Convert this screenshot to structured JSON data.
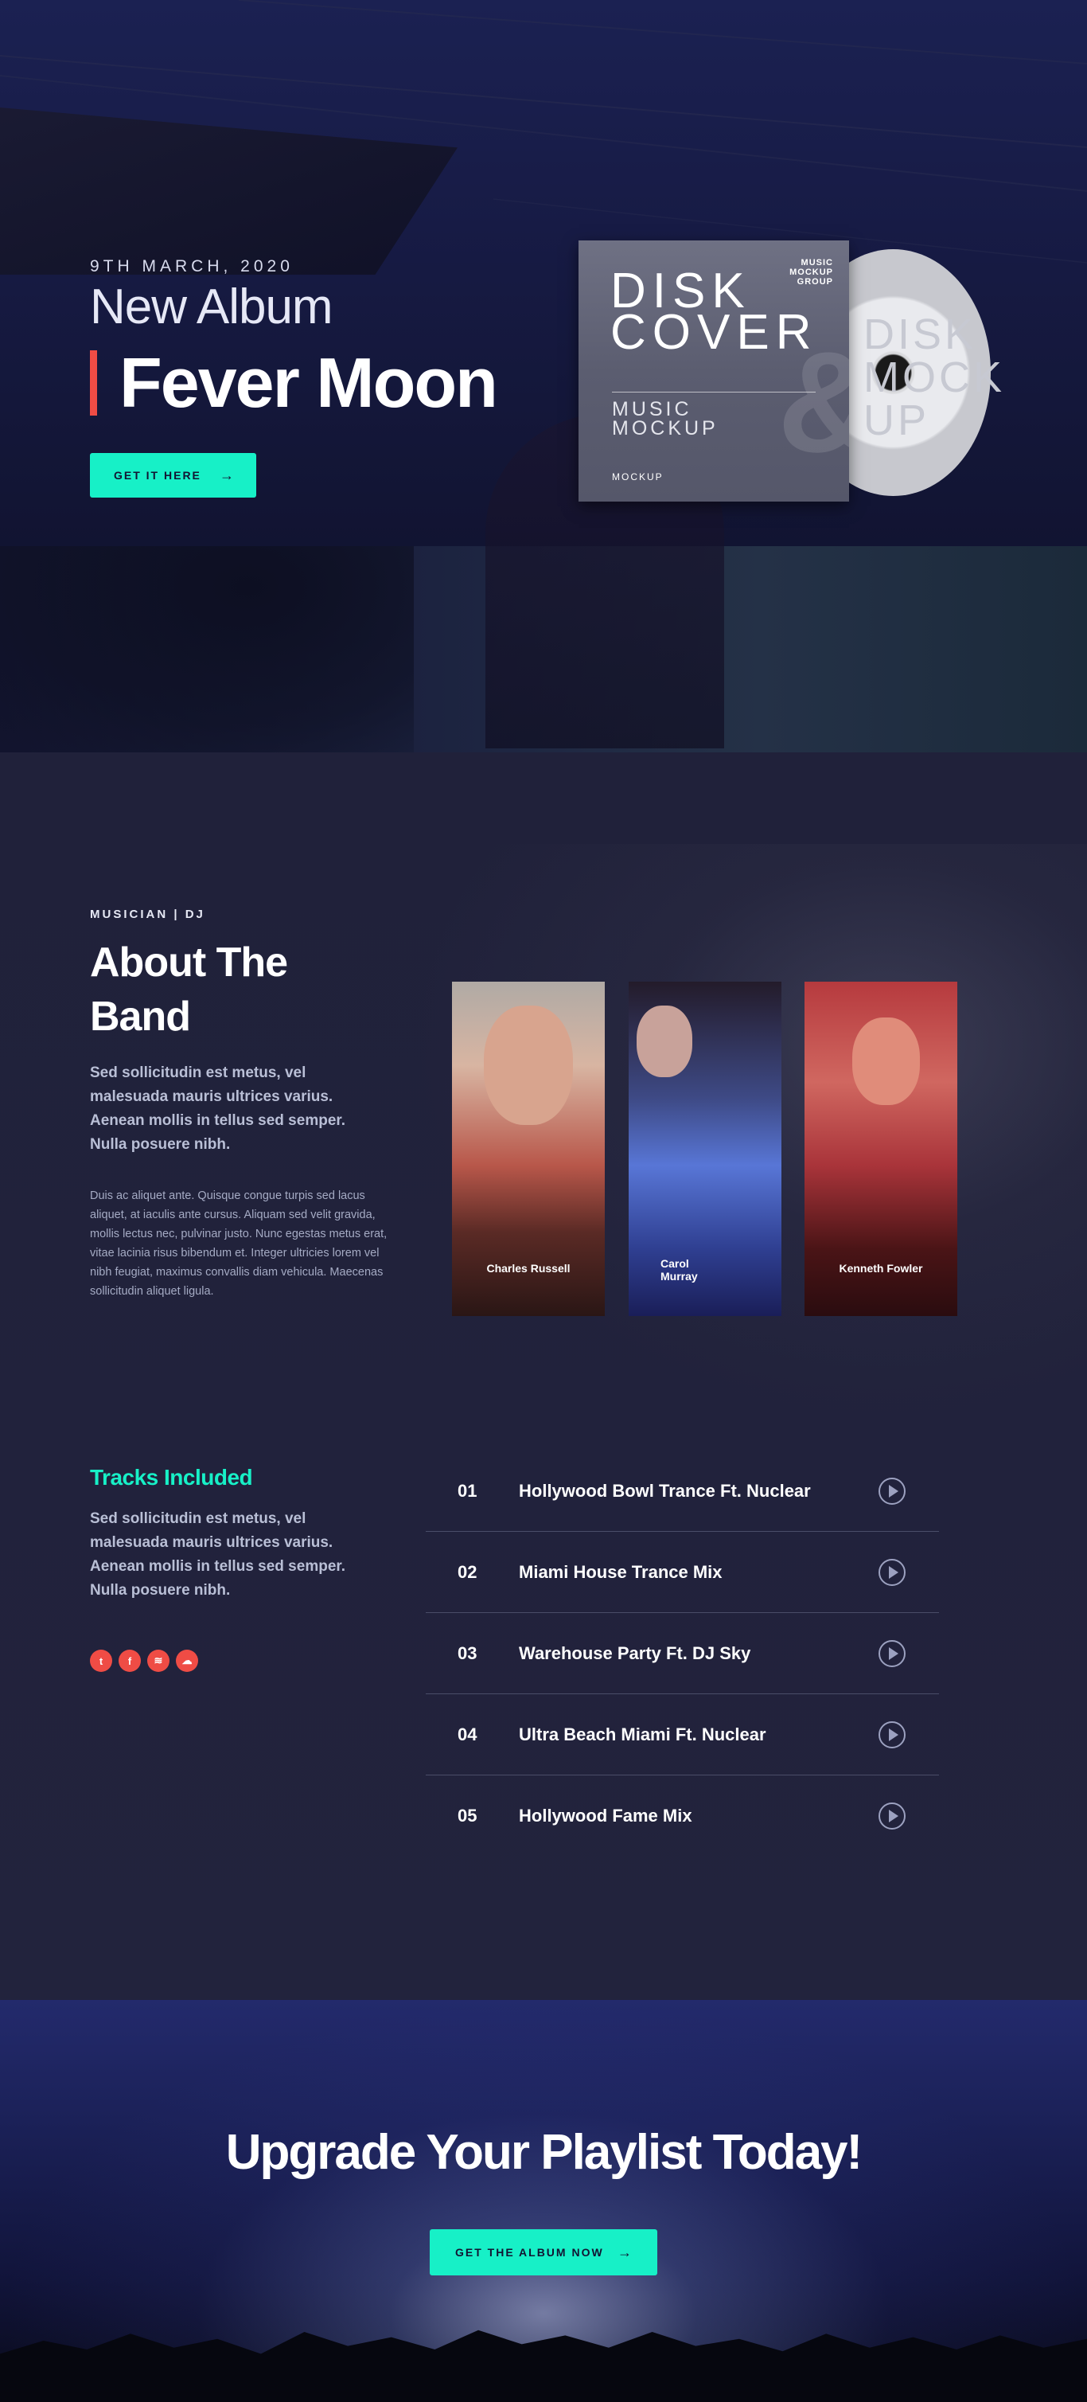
{
  "hero": {
    "date": "9TH MARCH, 2020",
    "subtitle": "New Album",
    "title": "Fever Moon",
    "button_label": "GET IT HERE",
    "button_arrow": "→",
    "cover": {
      "title_line1": "DISK",
      "title_line2": "COVER",
      "badge_line1": "MUSIC",
      "badge_line2": "MOCKUP",
      "badge_line3": "GROUP",
      "sub_line1": "MUSIC",
      "sub_line2": "MOCKUP",
      "logo": "MOCKUP",
      "disc_text": "DISK MOCK UP"
    }
  },
  "about": {
    "eyebrow": "MUSICIAN | DJ",
    "title": "About The Band",
    "lead": "Sed sollicitudin est metus, vel malesuada mauris ultrices varius. Aenean mollis in tellus sed semper. Nulla posuere nibh.",
    "body": "Duis ac aliquet ante. Quisque congue turpis sed lacus aliquet, at iaculis ante cursus. Aliquam sed velit gravida, mollis lectus nec, pulvinar justo. Nunc egestas metus erat, vitae lacinia risus bibendum et. Integer ultricies lorem vel nibh feugiat, maximus convallis diam vehicula. Maecenas sollicitudin aliquet ligula.",
    "members": [
      {
        "name": "Charles Russell"
      },
      {
        "name": "Carol Murray"
      },
      {
        "name": "Kenneth Fowler"
      }
    ]
  },
  "tracks": {
    "title": "Tracks Included",
    "lead": "Sed sollicitudin est metus, vel malesuada mauris ultrices varius. Aenean mollis in tellus sed semper. Nulla posuere nibh.",
    "socials": [
      {
        "icon": "twitter-icon",
        "glyph": "t"
      },
      {
        "icon": "facebook-icon",
        "glyph": "f"
      },
      {
        "icon": "spotify-icon",
        "glyph": "≋"
      },
      {
        "icon": "soundcloud-icon",
        "glyph": "☁"
      }
    ],
    "list": [
      {
        "num": "01",
        "title": "Hollywood Bowl Trance Ft. Nuclear"
      },
      {
        "num": "02",
        "title": "Miami House Trance Mix"
      },
      {
        "num": "03",
        "title": "Warehouse Party Ft. DJ Sky"
      },
      {
        "num": "04",
        "title": "Ultra Beach Miami Ft. Nuclear"
      },
      {
        "num": "05",
        "title": "Hollywood Fame Mix"
      }
    ]
  },
  "cta": {
    "title": "Upgrade Your Playlist Today!",
    "button_label": "GET THE ALBUM NOW",
    "button_arrow": "→"
  },
  "colors": {
    "accent": "#17f0c7",
    "highlight": "#ef4c45",
    "background": "#20213a"
  }
}
